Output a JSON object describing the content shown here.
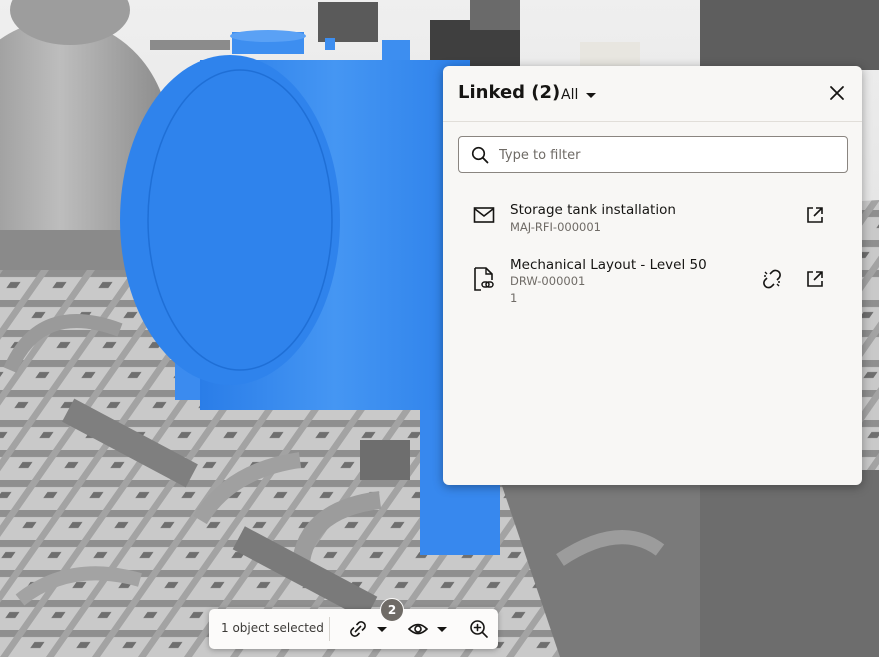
{
  "panel": {
    "title": "Linked (2)",
    "filter_value": "All",
    "search_placeholder": "Type to filter",
    "items": [
      {
        "icon": "mail-icon",
        "title": "Storage tank installation",
        "subtitle": "MAJ-RFI-000001",
        "extra": ""
      },
      {
        "icon": "linked-document-icon",
        "title": "Mechanical Layout - Level 50",
        "subtitle": "DRW-000001",
        "extra": "1"
      }
    ]
  },
  "toolbar": {
    "selection_text": "1 object selected",
    "link_count": "2"
  },
  "colors": {
    "accent_blue": "#3d8ef0",
    "panel_bg": "#f8f7f5",
    "badge": "#6f6b66"
  }
}
